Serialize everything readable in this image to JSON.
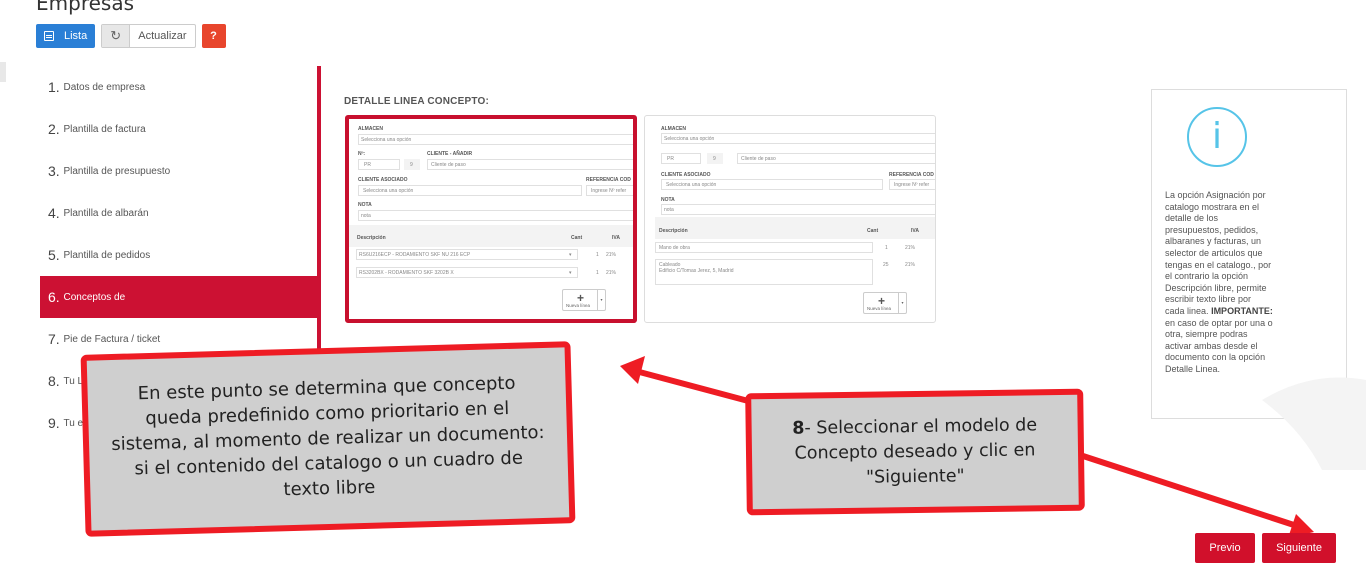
{
  "page": {
    "title": "Empresas"
  },
  "toolbar": {
    "lista_label": "Lista",
    "refresh_label": "Actualizar",
    "help_label": "?"
  },
  "steps": [
    {
      "num": "1.",
      "label": "Datos de empresa"
    },
    {
      "num": "2.",
      "label": "Plantilla de factura"
    },
    {
      "num": "3.",
      "label": "Plantilla de presupuesto"
    },
    {
      "num": "4.",
      "label": "Plantilla de albarán"
    },
    {
      "num": "5.",
      "label": "Plantilla de pedidos"
    },
    {
      "num": "6.",
      "label": "Conceptos de",
      "active": true
    },
    {
      "num": "7.",
      "label": "Pie de Factura / ticket"
    },
    {
      "num": "8.",
      "label": "Tu L"
    },
    {
      "num": "9.",
      "label": "Tu er"
    }
  ],
  "detalle": {
    "title": "DETALLE LINEA CONCEPTO:"
  },
  "concept_catalog": {
    "almacen_label": "ALMACEN",
    "almacen_value": "Selecciona una opción",
    "nr_label": "Nº:",
    "cliente_label": "CLIENTE - AÑADIR",
    "serie": "PR",
    "numero": "9",
    "cliente_value": "Cliente de paso",
    "cliente_asociado_label": "CLIENTE ASOCIADO",
    "cliente_asociado_value": "Selecciona una opción",
    "referencia_label": "REFERENCIA COD",
    "referencia_value": "Ingrese Nº refer",
    "nota_label": "NOTA",
    "nota_placeholder": "nota",
    "col_descripcion": "Descripción",
    "col_cant": "Cant",
    "col_iva": "IVA",
    "lines": [
      {
        "desc": "RS6U216ECP - RODAMIENTO SKF NU 216 ECP",
        "cant": "1",
        "iva": "21%"
      },
      {
        "desc": "RS3202BX - RODAMIENTO SKF 3202B X",
        "cant": "1",
        "iva": "21%"
      }
    ],
    "nueva_linea": "Nueva línea"
  },
  "concept_free": {
    "almacen_label": "ALMACEN",
    "almacen_value": "Selecciona una opción",
    "serie": "PR",
    "numero": "9",
    "cliente_value": "Cliente de paso",
    "cliente_asociado_label": "CLIENTE ASOCIADO",
    "cliente_asociado_value": "Selecciona una opción",
    "referencia_label": "REFERENCIA COD",
    "referencia_value": "Ingrese Nº refer",
    "nota_label": "NOTA",
    "nota_placeholder": "nota",
    "col_descripcion": "Descripción",
    "col_cant": "Cant",
    "col_iva": "IVA",
    "line1_desc": "Mano de obra",
    "line1_cant": "1",
    "line1_iva": "21%",
    "line2_desc_1": "Cableado",
    "line2_desc_2": "Edificio C/Tomas Jerez, 5, Madrid",
    "line2_cant": "25",
    "line2_iva": "21%",
    "nueva_linea": "Nueva línea"
  },
  "info": {
    "icon": "info-icon",
    "text_main": "La opción Asignación por catalogo mostrara en el detalle de los presupuestos, pedidos, albaranes y facturas, un selector de articulos que tengas en el catalogo., por el contrario la opción Descripción libre, permite escribir texto libre por cada linea.",
    "important_label": "IMPORTANTE:",
    "text_important": " en caso de optar por una o otra, siempre podras activar ambas desde el documento con la opción Detalle Linea."
  },
  "callouts": {
    "left_text": "En este punto se determina que concepto queda predefinido como prioritario en el sistema, al momento de realizar un documento: si el contenido del catalogo o un cuadro de texto libre",
    "right_num": "8",
    "right_text": "- Seleccionar el modelo de Concepto deseado y clic en \"Siguiente\""
  },
  "nav": {
    "previo": "Previo",
    "siguiente": "Siguiente"
  },
  "colors": {
    "accent": "#cc1133",
    "callout_border": "#ee1c24",
    "info_icon": "#56c4e8",
    "primary": "#2a7fd6"
  }
}
